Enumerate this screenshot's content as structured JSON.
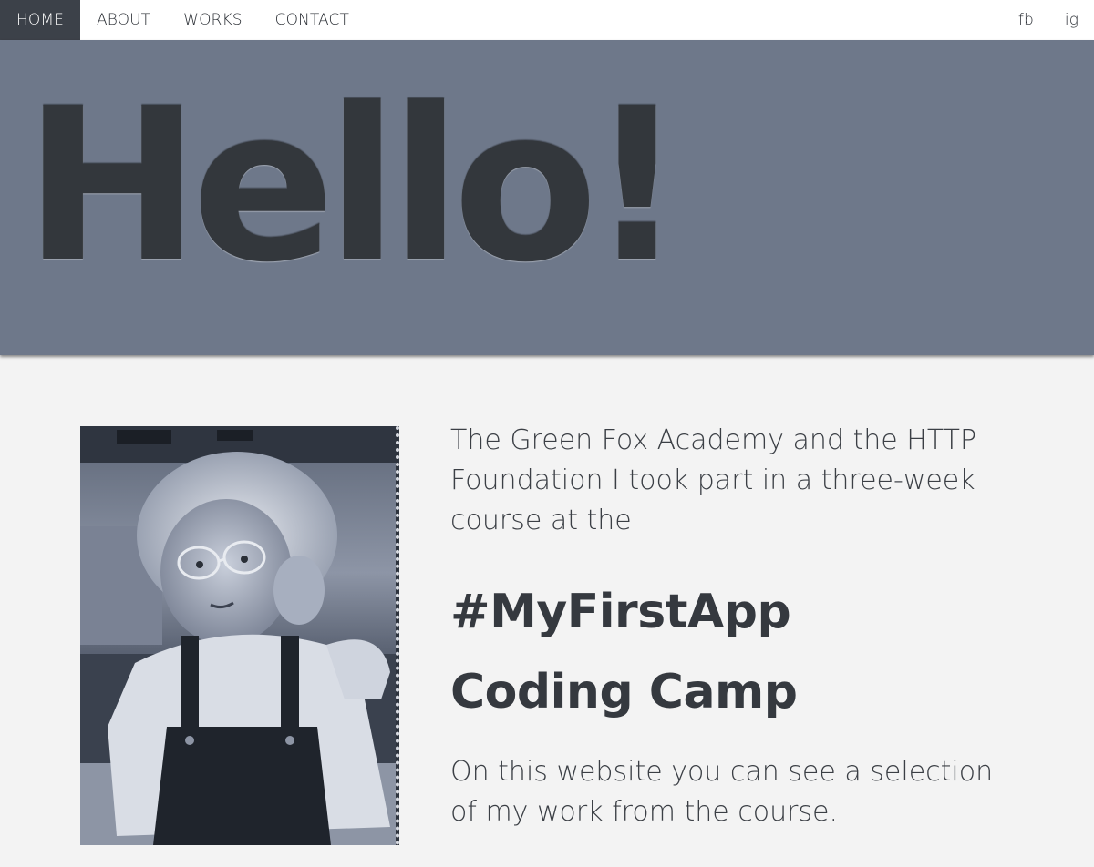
{
  "nav": {
    "left": [
      "HOME",
      "ABOUT",
      "WORKS",
      "CONTACT"
    ],
    "right": [
      "fb",
      "ig"
    ],
    "active": "HOME"
  },
  "hero": {
    "title": "Hello!",
    "background_color": "#6e788a",
    "title_color": "#33373c"
  },
  "main": {
    "intro": "The Green Fox Academy and the HTTP Foundation I took part in a three-week course at the",
    "headline_line1": "#MyFirstApp",
    "headline_line2": "Coding Camp",
    "outro": "On this website you can see a selection of my work from the course."
  }
}
